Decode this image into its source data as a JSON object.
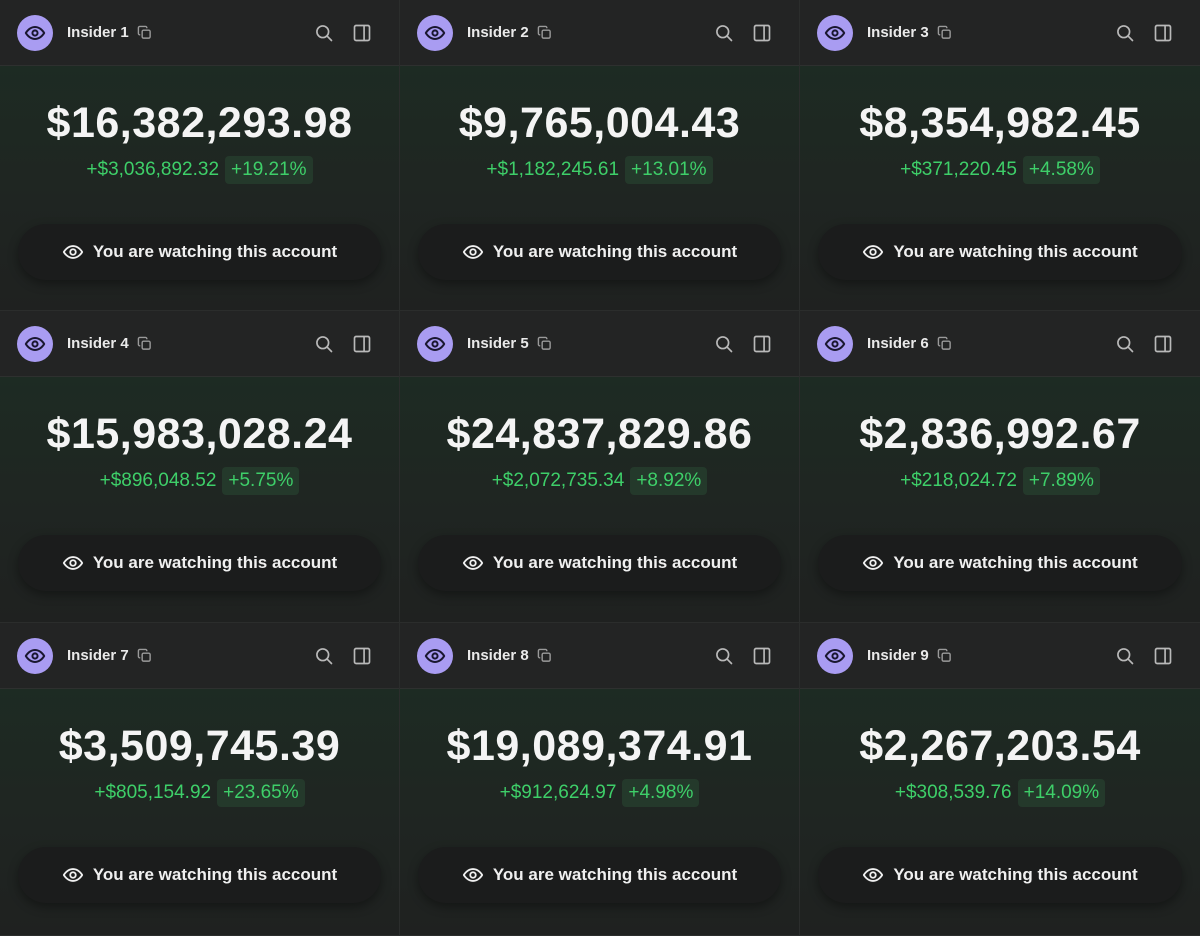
{
  "watch_label": "You are watching this account",
  "accent": "#a99cf2",
  "positive_color": "#3ecf69",
  "icons": {
    "avatar": "eye-icon",
    "copy": "copy-icon",
    "search": "search-icon",
    "panel": "panel-toggle-icon",
    "watch": "eye-icon"
  },
  "cards": [
    {
      "name": "Insider 1",
      "balance": "$16,382,293.98",
      "change_amount": "+$3,036,892.32",
      "change_pct": "+19.21%"
    },
    {
      "name": "Insider 2",
      "balance": "$9,765,004.43",
      "change_amount": "+$1,182,245.61",
      "change_pct": "+13.01%"
    },
    {
      "name": "Insider 3",
      "balance": "$8,354,982.45",
      "change_amount": "+$371,220.45",
      "change_pct": "+4.58%"
    },
    {
      "name": "Insider 4",
      "balance": "$15,983,028.24",
      "change_amount": "+$896,048.52",
      "change_pct": "+5.75%"
    },
    {
      "name": "Insider 5",
      "balance": "$24,837,829.86",
      "change_amount": "+$2,072,735.34",
      "change_pct": "+8.92%"
    },
    {
      "name": "Insider 6",
      "balance": "$2,836,992.67",
      "change_amount": "+$218,024.72",
      "change_pct": "+7.89%"
    },
    {
      "name": "Insider 7",
      "balance": "$3,509,745.39",
      "change_amount": "+$805,154.92",
      "change_pct": "+23.65%"
    },
    {
      "name": "Insider 8",
      "balance": "$19,089,374.91",
      "change_amount": "+$912,624.97",
      "change_pct": "+4.98%"
    },
    {
      "name": "Insider 9",
      "balance": "$2,267,203.54",
      "change_amount": "+$308,539.76",
      "change_pct": "+14.09%"
    }
  ]
}
